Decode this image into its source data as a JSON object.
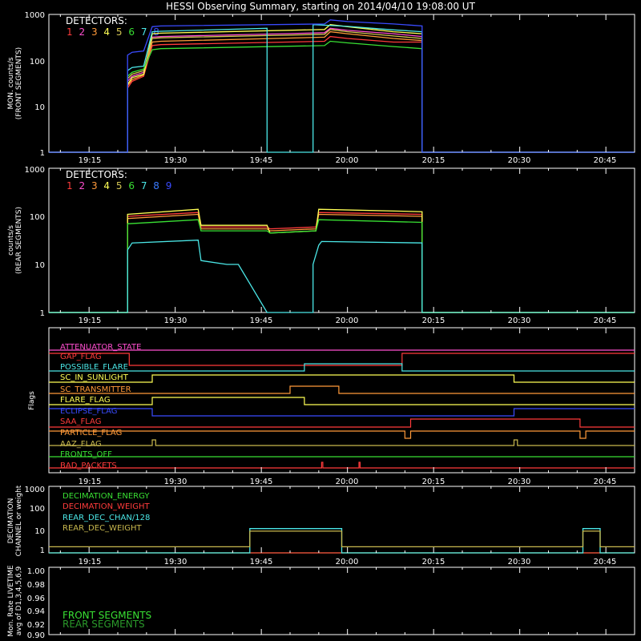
{
  "title": "HESSI Observing Summary, starting on 2014/04/10 19:08:00 UT",
  "time_ticks": [
    "19:15",
    "19:30",
    "19:45",
    "20:00",
    "20:15",
    "20:30",
    "20:45"
  ],
  "colors": {
    "d1": "#ff3b3b",
    "d2": "#ff4fd0",
    "d3": "#ff9a3a",
    "d4": "#ffff55",
    "d5": "#d2c452",
    "d6": "#39e033",
    "d7": "#4be7e7",
    "d8": "#3a7bff",
    "d9": "#3a4bff",
    "axis": "#ffffff"
  },
  "front_panel": {
    "ylabel_lines": [
      "MON. counts/s",
      "(FRONT SEGMENTS)"
    ],
    "yticks": [
      "1000",
      "100",
      "10",
      "1"
    ],
    "legend_title": "DETECTORS:",
    "detector_labels": [
      "1",
      "2",
      "3",
      "4",
      "5",
      "6",
      "7",
      "8"
    ]
  },
  "rear_panel": {
    "ylabel_lines": [
      "counts/s",
      "(REAR SEGMENTS)"
    ],
    "yticks": [
      "1000",
      "100",
      "10",
      "1"
    ],
    "legend_title": "DETECTORS:",
    "detector_labels": [
      "1",
      "2",
      "3",
      "4",
      "5",
      "6",
      "7",
      "8",
      "9"
    ]
  },
  "flags_panel": {
    "ylabel": "Flags",
    "flags": [
      {
        "label": "ATTENUATOR_STATE",
        "color": "#ff4fd0"
      },
      {
        "label": "GAP_FLAG",
        "color": "#ff3b3b"
      },
      {
        "label": "POSSIBLE_FLARE",
        "color": "#4be7e7"
      },
      {
        "label": "SC_IN_SUNLIGHT",
        "color": "#ffff55"
      },
      {
        "label": "SC_TRANSMITTER",
        "color": "#ff9a3a"
      },
      {
        "label": "FLARE_FLAG",
        "color": "#ffff55"
      },
      {
        "label": "ECLIPSE_FLAG",
        "color": "#3a4bff"
      },
      {
        "label": "SAA_FLAG",
        "color": "#ff3b3b"
      },
      {
        "label": "PARTICLE_FLAG",
        "color": "#ff9a3a"
      },
      {
        "label": "AAZ_FLAG",
        "color": "#c8b84e"
      },
      {
        "label": "FRONTS_OFF",
        "color": "#39e033"
      },
      {
        "label": "BAD_PACKETS",
        "color": "#ff3b3b"
      }
    ]
  },
  "decimation_panel": {
    "ylabel_lines": [
      "DECIMATION",
      "CHANNEL or weight"
    ],
    "yticks": [
      "1000",
      "100",
      "10",
      "1"
    ],
    "legend": [
      {
        "label": "DECIMATION_ENERGY",
        "color": "#39e033"
      },
      {
        "label": "DECIMATION_WEIGHT",
        "color": "#ff3b3b"
      },
      {
        "label": "REAR_DEC_CHAN/128",
        "color": "#4be7e7"
      },
      {
        "label": "REAR_DEC_WEIGHT",
        "color": "#c8b84e"
      }
    ]
  },
  "livetime_panel": {
    "ylabel_lines": [
      "Mon. Rate LIVETIME",
      "avg of D1,3,4,5,6,9"
    ],
    "yticks": [
      "1.00",
      "0.98",
      "0.96",
      "0.94",
      "0.92",
      "0.90"
    ],
    "legend": [
      {
        "label": "FRONT SEGMENTS",
        "color": "#39e033"
      },
      {
        "label": "REAR SEGMENTS",
        "color": "#2a9a2a"
      }
    ]
  },
  "chart_data": [
    {
      "type": "line",
      "panel": "front",
      "x_unit": "minutes after 19:08:00 UT",
      "xlim": [
        0,
        102
      ],
      "yscale": "log",
      "ylim": [
        1,
        1000
      ],
      "series": [
        {
          "detector": "1",
          "color": "#ff3b3b",
          "x": [
            0,
            13.7,
            13.7,
            14.5,
            16.5,
            18,
            19.5,
            48,
            49,
            52,
            60,
            65,
            65,
            102
          ],
          "y": [
            1,
            1,
            25,
            35,
            45,
            210,
            220,
            260,
            330,
            300,
            250,
            250,
            1,
            1
          ]
        },
        {
          "detector": "2",
          "color": "#ff4fd0",
          "x": [
            0,
            13.7,
            13.7,
            14.5,
            16.5,
            18,
            19.5,
            48,
            49,
            52,
            60,
            65,
            65,
            102
          ],
          "y": [
            1,
            1,
            35,
            45,
            55,
            320,
            330,
            400,
            500,
            450,
            380,
            330,
            1,
            1
          ]
        },
        {
          "detector": "3",
          "color": "#ff9a3a",
          "x": [
            0,
            13.7,
            13.7,
            14.5,
            16.5,
            18,
            19.5,
            48,
            49,
            52,
            60,
            65,
            65,
            102
          ],
          "y": [
            1,
            1,
            28,
            38,
            48,
            250,
            260,
            320,
            420,
            380,
            300,
            270,
            1,
            1
          ]
        },
        {
          "detector": "4",
          "color": "#ffff55",
          "x": [
            0,
            13.7,
            13.7,
            14.5,
            16.5,
            18,
            19.5,
            48,
            49,
            52,
            60,
            65,
            65,
            102
          ],
          "y": [
            1,
            1,
            30,
            42,
            50,
            380,
            390,
            470,
            600,
            540,
            420,
            380,
            1,
            1
          ]
        },
        {
          "detector": "5",
          "color": "#d2c452",
          "x": [
            0,
            13.7,
            13.7,
            14.5,
            16.5,
            18,
            19.5,
            48,
            49,
            52,
            60,
            65,
            65,
            102
          ],
          "y": [
            1,
            1,
            40,
            50,
            60,
            300,
            310,
            370,
            470,
            420,
            340,
            300,
            1,
            1
          ]
        },
        {
          "detector": "6",
          "color": "#39e033",
          "x": [
            0,
            13.7,
            13.7,
            14.5,
            16.5,
            18,
            19.5,
            48,
            49,
            52,
            60,
            65,
            65,
            102
          ],
          "y": [
            1,
            1,
            45,
            55,
            65,
            170,
            180,
            210,
            260,
            240,
            200,
            180,
            1,
            1
          ]
        },
        {
          "detector": "7",
          "color": "#4be7e7",
          "x": [
            0,
            13.7,
            13.7,
            14.5,
            16.5,
            18,
            19.5,
            38,
            38,
            46,
            46,
            52,
            60,
            65,
            65,
            102
          ],
          "y": [
            1,
            1,
            60,
            70,
            75,
            420,
            430,
            500,
            1,
            1,
            600,
            550,
            460,
            420,
            1,
            1
          ]
        },
        {
          "detector": "8",
          "color": "#3a4bff",
          "x": [
            0,
            13.7,
            13.7,
            14.5,
            16.5,
            18,
            19.5,
            48,
            49,
            52,
            60,
            65,
            65,
            102
          ],
          "y": [
            1,
            1,
            130,
            150,
            160,
            540,
            560,
            620,
            760,
            700,
            620,
            560,
            1,
            1
          ]
        }
      ]
    },
    {
      "type": "line",
      "panel": "rear",
      "x_unit": "minutes after 19:08:00 UT",
      "xlim": [
        0,
        102
      ],
      "yscale": "log",
      "ylim": [
        1,
        1000
      ],
      "series": [
        {
          "detector": "1",
          "color": "#ff3b3b",
          "x": [
            0,
            13.7,
            13.7,
            26,
            26.5,
            38,
            38.5,
            46.5,
            47,
            65,
            65,
            102
          ],
          "y": [
            1,
            1,
            100,
            120,
            60,
            60,
            55,
            60,
            120,
            110,
            1,
            1
          ]
        },
        {
          "detector": "3",
          "color": "#ff9a3a",
          "x": [
            0,
            13.7,
            13.7,
            26,
            26.5,
            38,
            38.5,
            46.5,
            47,
            65,
            65,
            102
          ],
          "y": [
            1,
            1,
            90,
            110,
            55,
            55,
            50,
            55,
            110,
            100,
            1,
            1
          ]
        },
        {
          "detector": "4",
          "color": "#ffff55",
          "x": [
            0,
            13.7,
            13.7,
            26,
            26.5,
            38,
            38.5,
            46.5,
            47,
            65,
            65,
            102
          ],
          "y": [
            1,
            1,
            110,
            140,
            65,
            65,
            45,
            50,
            140,
            125,
            1,
            1
          ]
        },
        {
          "detector": "6",
          "color": "#39e033",
          "x": [
            0,
            13.7,
            13.7,
            26,
            26.5,
            38,
            38.5,
            46.5,
            47,
            65,
            65,
            102
          ],
          "y": [
            1,
            1,
            70,
            85,
            50,
            50,
            45,
            50,
            85,
            75,
            1,
            1
          ]
        },
        {
          "detector": "7",
          "color": "#4be7e7",
          "x": [
            0,
            13.7,
            13.7,
            14.5,
            26,
            26.5,
            31,
            33,
            38,
            38,
            46,
            46,
            47,
            47.5,
            65,
            65,
            102
          ],
          "y": [
            1,
            1,
            20,
            28,
            32,
            12,
            10,
            10,
            1,
            1,
            1,
            10,
            25,
            30,
            28,
            1,
            1
          ]
        }
      ]
    },
    {
      "type": "step",
      "panel": "flags",
      "x_unit": "minutes after 19:08:00 UT",
      "xlim": [
        0,
        102
      ],
      "series": [
        {
          "name": "ATTENUATOR_STATE",
          "color": "#ff4fd0",
          "x": [
            0,
            102
          ],
          "y": [
            0,
            0
          ]
        },
        {
          "name": "GAP_FLAG",
          "color": "#ff3b3b",
          "x": [
            0,
            14,
            14,
            61.5,
            61.5,
            102
          ],
          "y": [
            1,
            1,
            0,
            0,
            1,
            1
          ]
        },
        {
          "name": "POSSIBLE_FLARE",
          "color": "#4be7e7",
          "x": [
            0,
            44.5,
            44.5,
            61.5,
            61.5,
            102
          ],
          "y": [
            0,
            0,
            1,
            1,
            0,
            0
          ]
        },
        {
          "name": "SC_IN_SUNLIGHT",
          "color": "#ffff55",
          "x": [
            0,
            18,
            18,
            81,
            81,
            102
          ],
          "y": [
            0,
            0,
            1,
            1,
            0,
            0
          ]
        },
        {
          "name": "SC_TRANSMITTER",
          "color": "#ff9a3a",
          "x": [
            0,
            42,
            42,
            50.5,
            50.5,
            102
          ],
          "y": [
            0,
            0,
            1,
            1,
            0,
            0
          ]
        },
        {
          "name": "FLARE_FLAG",
          "color": "#ffff55",
          "x": [
            0,
            18,
            18,
            44.5,
            44.5,
            102
          ],
          "y": [
            0,
            0,
            1,
            1,
            0,
            0
          ]
        },
        {
          "name": "ECLIPSE_FLAG",
          "color": "#3a4bff",
          "x": [
            0,
            18,
            18,
            81,
            81,
            102
          ],
          "y": [
            1,
            1,
            0,
            0,
            1,
            1
          ]
        },
        {
          "name": "SAA_FLAG",
          "color": "#ff3b3b",
          "x": [
            0,
            63,
            63,
            92.5,
            92.5,
            102
          ],
          "y": [
            0,
            0,
            1,
            1,
            0,
            0
          ]
        },
        {
          "name": "PARTICLE_FLAG",
          "color": "#ff9a3a",
          "x": [
            0,
            62,
            62,
            63,
            63,
            92.5,
            92.5,
            93.5,
            93.5,
            102
          ],
          "y": [
            1,
            1,
            0,
            0,
            1,
            1,
            0,
            0,
            1,
            1
          ]
        },
        {
          "name": "AAZ_FLAG",
          "color": "#c8b84e",
          "x": [
            0,
            18,
            18,
            18.6,
            18.6,
            81,
            81,
            81.6,
            81.6,
            102
          ],
          "y": [
            0,
            0,
            1,
            1,
            0,
            0,
            1,
            1,
            0,
            0
          ]
        },
        {
          "name": "FRONTS_OFF",
          "color": "#39e033",
          "x": [
            0,
            102
          ],
          "y": [
            1,
            1
          ]
        },
        {
          "name": "BAD_PACKETS",
          "color": "#ff3b3b",
          "x": [
            0,
            47.5,
            47.5,
            47.7,
            47.7,
            54,
            54,
            54.2,
            54.2,
            102
          ],
          "y": [
            0,
            0,
            1,
            1,
            0,
            0,
            1,
            1,
            0,
            0
          ]
        }
      ]
    },
    {
      "type": "step",
      "panel": "decimation",
      "x_unit": "minutes after 19:08:00 UT",
      "xlim": [
        0,
        102
      ],
      "yscale": "log",
      "ylim": [
        0.5,
        1000
      ],
      "series": [
        {
          "name": "DECIMATION_ENERGY",
          "color": "#39e033",
          "x": [
            0,
            102
          ],
          "y": [
            0.5,
            0.5
          ]
        },
        {
          "name": "DECIMATION_WEIGHT",
          "color": "#ff3b3b",
          "x": [
            0,
            102
          ],
          "y": [
            0.5,
            0.5
          ]
        },
        {
          "name": "REAR_DEC_CHAN/128",
          "color": "#4be7e7",
          "x": [
            0,
            35,
            35,
            51,
            51,
            93,
            93,
            96,
            96,
            102
          ],
          "y": [
            0.5,
            0.5,
            8,
            8,
            0.5,
            0.5,
            8,
            8,
            0.5,
            0.5
          ]
        },
        {
          "name": "REAR_DEC_WEIGHT",
          "color": "#c8b84e",
          "x": [
            0,
            35,
            35,
            51,
            51,
            93,
            93,
            96,
            96,
            102
          ],
          "y": [
            1,
            1,
            6,
            6,
            1,
            1,
            6,
            6,
            1,
            1
          ]
        }
      ]
    },
    {
      "type": "line",
      "panel": "livetime",
      "xlim": [
        0,
        102
      ],
      "ylim": [
        0.9,
        1.0
      ],
      "series": []
    }
  ]
}
